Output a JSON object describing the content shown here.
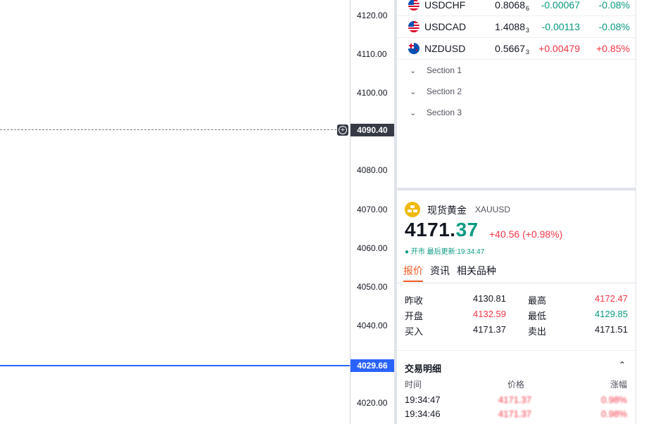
{
  "price_axis": {
    "ticks": [
      "4120.00",
      "4110.00",
      "4100.00",
      "4080.00",
      "4070.00",
      "4060.00",
      "4050.00",
      "4040.00",
      "4020.00"
    ],
    "crosshair_price": "4090.40",
    "current_price": "4029.66"
  },
  "watchlist": {
    "rows": [
      {
        "symbol": "USDCHF",
        "last_main": "0.8068",
        "last_sub": "6",
        "change": "-0.00067",
        "change_pct": "-0.08%",
        "direction": "down"
      },
      {
        "symbol": "USDCAD",
        "last_main": "1.4088",
        "last_sub": "3",
        "change": "-0.00113",
        "change_pct": "-0.08%",
        "direction": "down"
      },
      {
        "symbol": "NZDUSD",
        "last_main": "0.5667",
        "last_sub": "3",
        "change": "+0.00479",
        "change_pct": "+0.85%",
        "direction": "up"
      }
    ],
    "sections": [
      "Section 1",
      "Section 2",
      "Section 3"
    ]
  },
  "detail": {
    "name": "现货黄金",
    "ticker": "XAUUSD",
    "price_int": "4171.",
    "price_dec": "37",
    "change": "+40.56 (+0.98%)",
    "status": "● 开市 最后更新:19:34:47",
    "tabs": [
      "报价",
      "资讯",
      "相关品种"
    ],
    "stats": [
      {
        "label1": "昨收",
        "value1": "4130.81",
        "label2": "最高",
        "value2": "4172.47"
      },
      {
        "label1": "开盘",
        "value1": "4132.59",
        "label2": "最低",
        "value2": "4129.85"
      },
      {
        "label1": "买入",
        "value1": "4171.37",
        "label2": "卖出",
        "value2": "4171.51"
      }
    ],
    "trades_title": "交易明细",
    "trades_headers": [
      "时间",
      "价格",
      "涨幅"
    ],
    "trades": [
      {
        "time": "19:34:47",
        "price": "4171.37",
        "pct": "0.98%"
      },
      {
        "time": "19:34:46",
        "price": "4171.37",
        "pct": "0.98%"
      }
    ]
  },
  "colors": {
    "up": "#f23645",
    "down": "#089981",
    "accent": "#2962ff",
    "tab_active": "#f05a22",
    "gold": "#f0b90b"
  }
}
